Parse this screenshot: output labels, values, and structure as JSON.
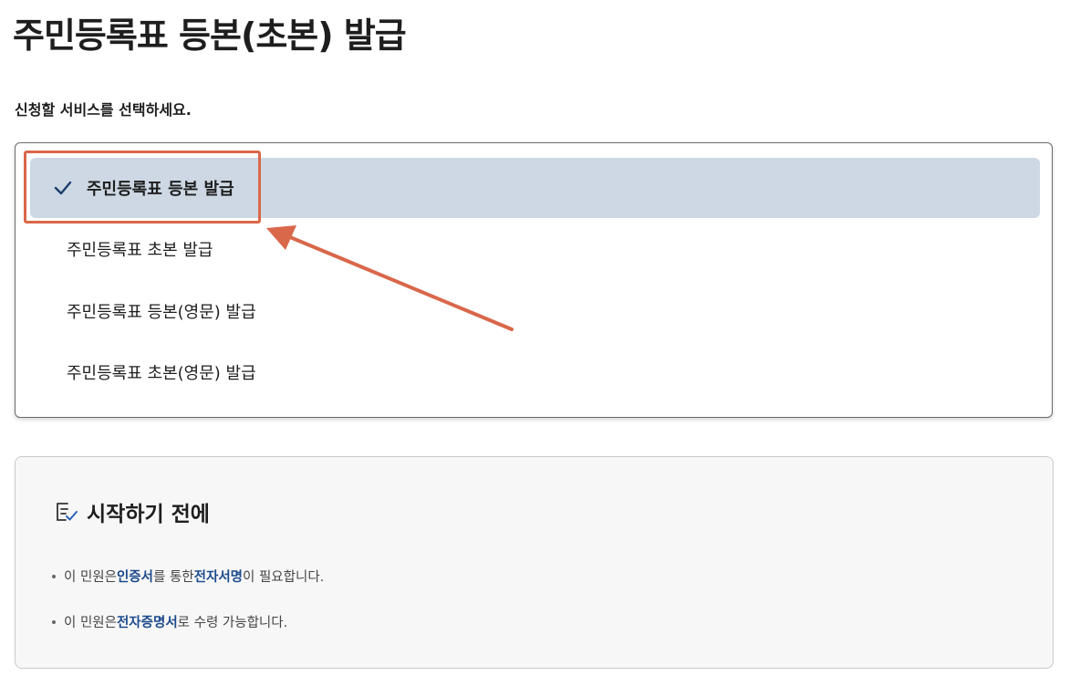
{
  "page": {
    "title": "주민등록표 등본(초본) 발급"
  },
  "prompt": "신청할 서비스를 선택하세요.",
  "services": [
    {
      "label": "주민등록표 등본 발급",
      "selected": true
    },
    {
      "label": "주민등록표 초본 발급",
      "selected": false
    },
    {
      "label": "주민등록표 등본(영문) 발급",
      "selected": false
    },
    {
      "label": "주민등록표 초본(영문) 발급",
      "selected": false
    }
  ],
  "info": {
    "title": "시작하기 전에",
    "icon": "checklist-icon",
    "bullets": [
      {
        "pre": "이 민원은 ",
        "hl1": "인증서",
        "mid": "를 통한 ",
        "hl2": "전자서명",
        "post": "이 필요합니다."
      },
      {
        "pre": "이 민원은 ",
        "hl1": "전자증명서",
        "post": "로 수령 가능합니다."
      }
    ]
  },
  "colors": {
    "selected_bg": "#cdd8e4",
    "highlight": "#d9674a",
    "accent_text": "#1c4a8c"
  }
}
